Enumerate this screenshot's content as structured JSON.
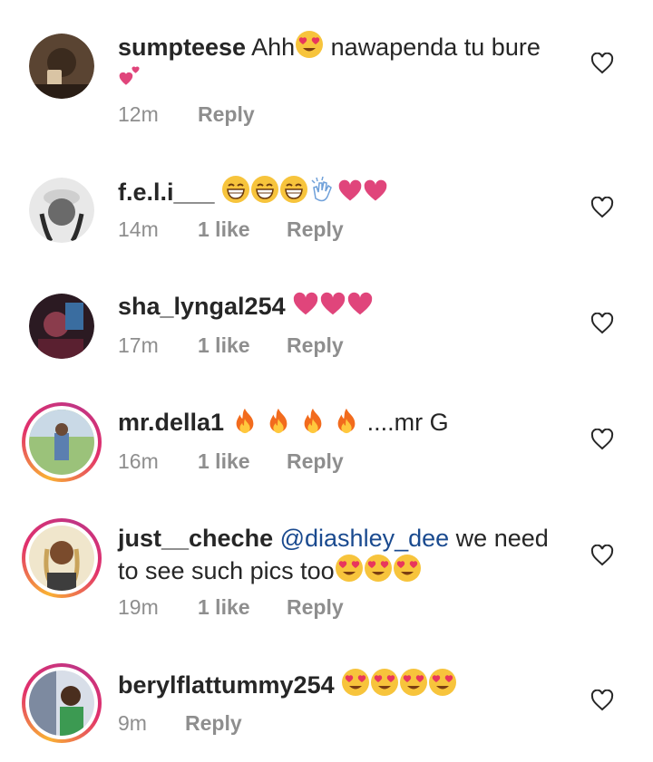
{
  "comments": [
    {
      "username": "sumpteese",
      "text_parts": [
        "Ahh",
        "nawapenda tu bure"
      ],
      "time": "12m",
      "likes": "",
      "reply": "Reply",
      "emoji": [
        "heart-eyes-face",
        "two-hearts"
      ]
    },
    {
      "username": "f.e.l.i___",
      "time": "14m",
      "likes": "1 like",
      "reply": "Reply",
      "emoji": [
        "grinning-face",
        "grinning-face",
        "grinning-face",
        "clapping-hands",
        "red-heart",
        "red-heart"
      ]
    },
    {
      "username": "sha_lyngal254",
      "time": "17m",
      "likes": "1 like",
      "reply": "Reply",
      "emoji": [
        "red-heart",
        "red-heart",
        "red-heart"
      ]
    },
    {
      "username": "mr.della1",
      "text_parts": [
        "....mr G"
      ],
      "time": "16m",
      "likes": "1 like",
      "reply": "Reply",
      "emoji": [
        "fire",
        "fire",
        "fire",
        "fire"
      ]
    },
    {
      "username": "just__cheche",
      "mention": "@diashley_dee",
      "text_parts": [
        "we need to see such pics too"
      ],
      "time": "19m",
      "likes": "1 like",
      "reply": "Reply",
      "emoji": [
        "heart-eyes-face",
        "heart-eyes-face",
        "heart-eyes-face"
      ]
    },
    {
      "username": "berylflattummy254",
      "time": "9m",
      "likes": "",
      "reply": "Reply",
      "emoji": [
        "heart-eyes-face",
        "heart-eyes-face",
        "heart-eyes-face",
        "heart-eyes-face"
      ]
    }
  ],
  "colors": {
    "text": "#262626",
    "meta": "#8e8e8e",
    "mention": "#1a4a8f",
    "heart_emoji": "#e0457b",
    "story_ring": "#e1306c"
  }
}
